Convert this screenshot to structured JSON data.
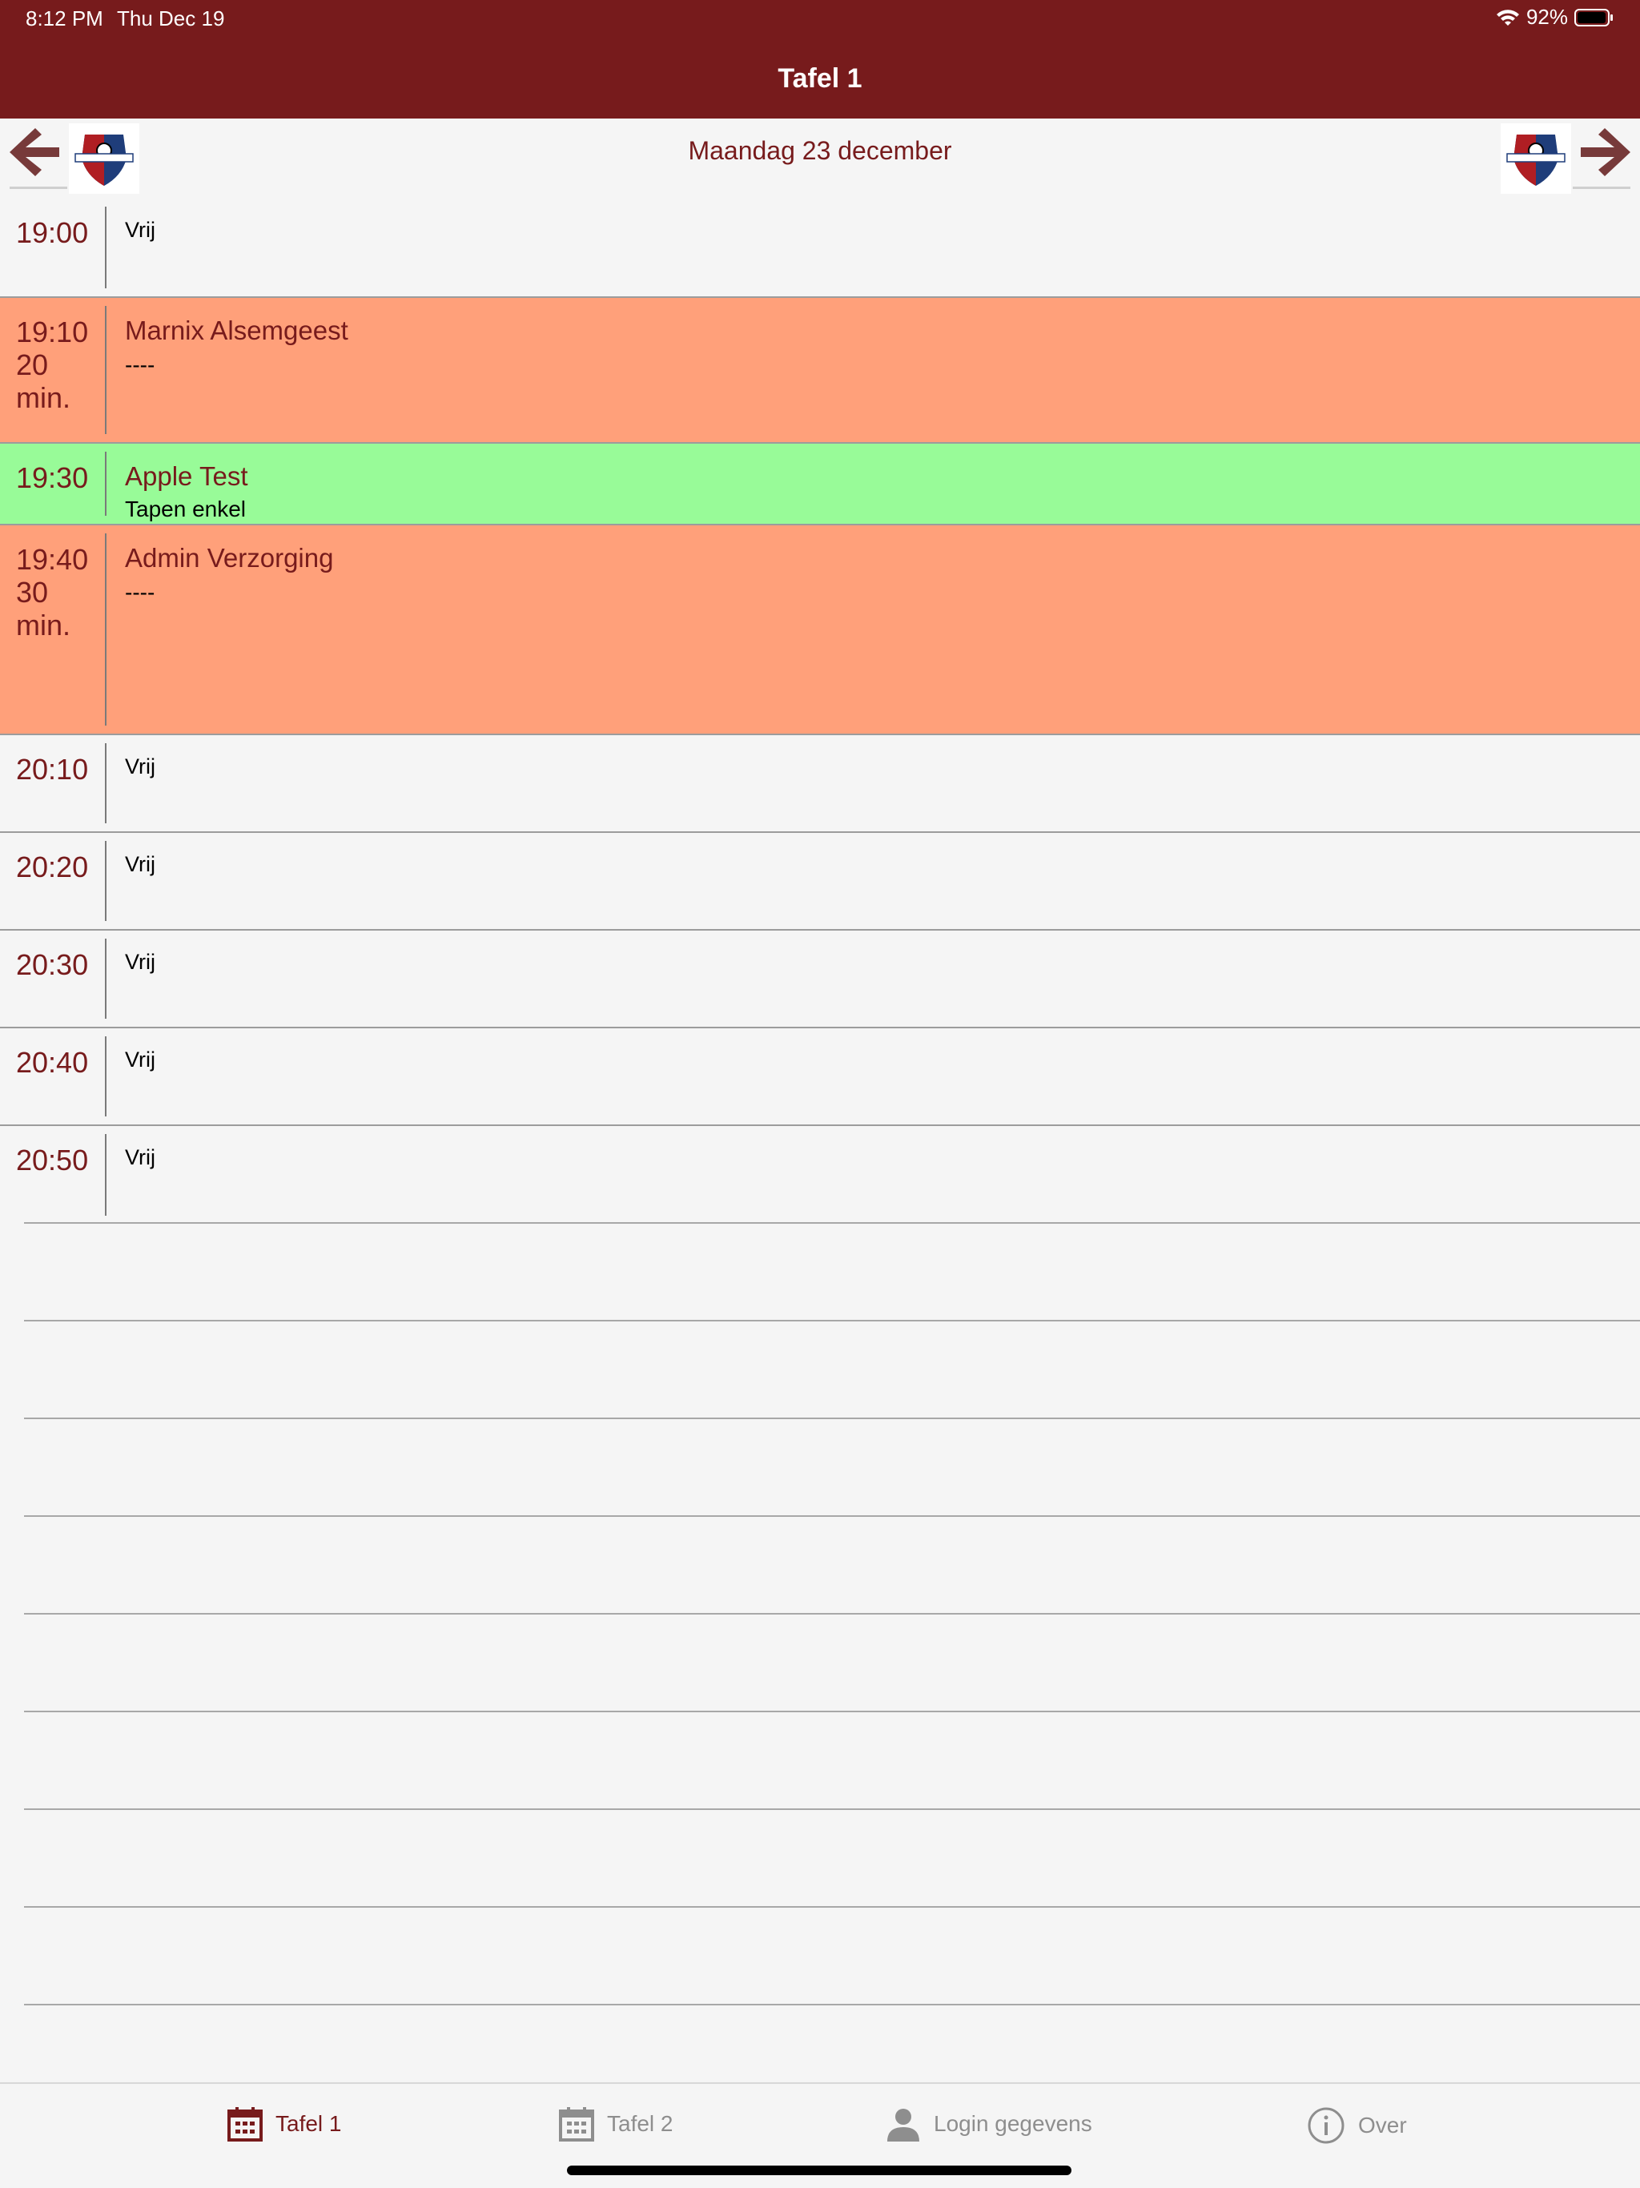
{
  "status": {
    "time": "8:12 PM",
    "date": "Thu Dec 19",
    "battery": "92%"
  },
  "nav": {
    "title": "Tafel 1"
  },
  "datebar": {
    "date": "Maandag 23 december"
  },
  "rows": [
    {
      "time": "19:00",
      "sub": "Vrij"
    },
    {
      "time": "19:10\n20\nmin.",
      "name": "Marnix Alsemgeest",
      "sub": "----"
    },
    {
      "time": "19:30",
      "name": "Apple Test",
      "sub": "Tapen enkel"
    },
    {
      "time": "19:40\n30\nmin.",
      "name": "Admin Verzorging",
      "sub": "----"
    },
    {
      "time": "20:10",
      "sub": "Vrij"
    },
    {
      "time": "20:20",
      "sub": "Vrij"
    },
    {
      "time": "20:30",
      "sub": "Vrij"
    },
    {
      "time": "20:40",
      "sub": "Vrij"
    },
    {
      "time": "20:50",
      "sub": "Vrij"
    }
  ],
  "tabs": [
    {
      "label": "Tafel 1",
      "icon": "calendar-icon",
      "active": true
    },
    {
      "label": "Tafel 2",
      "icon": "calendar-icon",
      "active": false
    },
    {
      "label": "Login gegevens",
      "icon": "user-icon",
      "active": false
    },
    {
      "label": "Over",
      "icon": "info-icon",
      "active": false
    }
  ],
  "colors": {
    "brand": "#771b1c",
    "booked": "#ffa07a",
    "confirmed": "#98fb98",
    "background": "#f5f5f5"
  }
}
